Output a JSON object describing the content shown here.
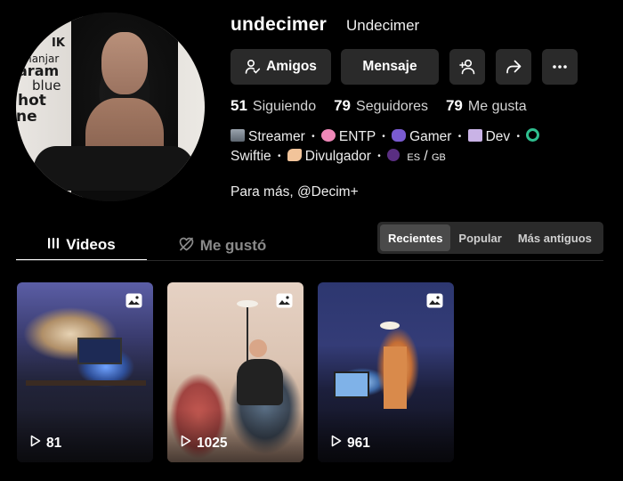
{
  "profile": {
    "username": "undecimer",
    "nickname": "Undecimer",
    "avatar_poster": [
      "IK",
      "manjar",
      "aram",
      "blue",
      "hot",
      "ne"
    ]
  },
  "actions": {
    "friends_label": "Amigos",
    "message_label": "Mensaje",
    "add_friend_icon": "person-plus-icon",
    "share_icon": "share-arrow-icon",
    "more_icon": "ellipsis-icon"
  },
  "stats": {
    "following_count": "51",
    "following_label": "Siguiendo",
    "followers_count": "79",
    "followers_label": "Seguidores",
    "likes_count": "79",
    "likes_label": "Me gusta"
  },
  "bio": {
    "tags": [
      {
        "icon": "movie-camera-icon",
        "label": "Streamer"
      },
      {
        "icon": "brain-icon",
        "label": "ENTP"
      },
      {
        "icon": "gamepad-icon",
        "label": "Gamer"
      },
      {
        "icon": "technologist-icon",
        "label": "Dev"
      },
      {
        "icon": "loop-icon",
        "label": "Swiftie"
      },
      {
        "icon": "writing-hand-icon",
        "label": "Divulgador"
      }
    ],
    "lang_es": "ES",
    "lang_sep": "/",
    "lang_gb": "GB",
    "separator": "•",
    "link_line": "Para más, @Decim+"
  },
  "tabs": {
    "videos": "Videos",
    "liked": "Me gustó"
  },
  "sort": {
    "options": [
      "Recientes",
      "Popular",
      "Más antiguos"
    ],
    "selected": "Recientes"
  },
  "videos": [
    {
      "views": "81",
      "type_icon": "photo-icon"
    },
    {
      "views": "1025",
      "type_icon": "photo-icon"
    },
    {
      "views": "961",
      "type_icon": "photo-icon"
    }
  ]
}
